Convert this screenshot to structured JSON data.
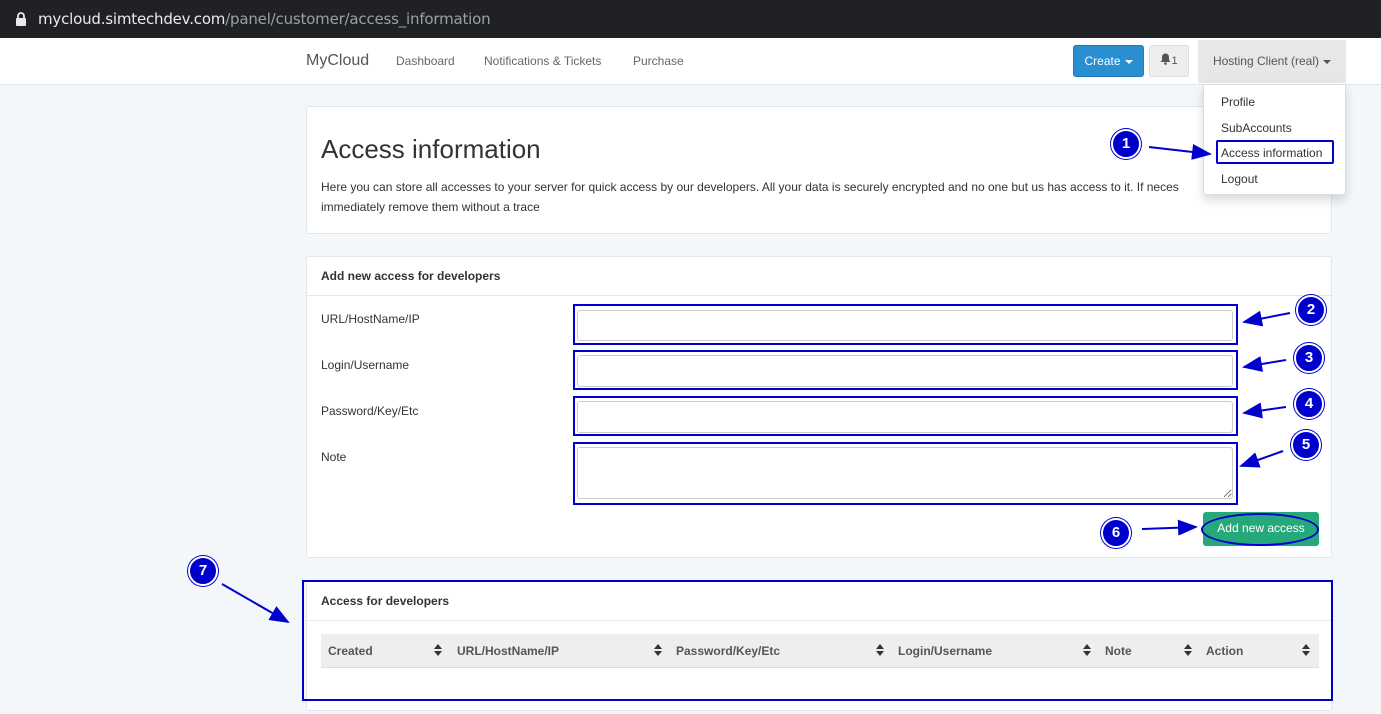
{
  "browser": {
    "url_host": "mycloud.simtechdev.com",
    "url_path": "/panel/customer/access_information"
  },
  "navbar": {
    "brand": "MyCloud",
    "links": [
      "Dashboard",
      "Notifications & Tickets",
      "Purchase"
    ],
    "create_label": "Create",
    "bell_count": "1",
    "user_label": "Hosting Client (real)"
  },
  "dropdown": {
    "items": [
      "Profile",
      "SubAccounts",
      "Access information",
      "Logout"
    ]
  },
  "intro": {
    "title": "Access information",
    "description": "Here you can store all accesses to your server for quick access by our developers. All your data is securely encrypted and no one but us has access to it. If neces immediately remove them without a trace"
  },
  "add_form": {
    "heading": "Add new access for developers",
    "fields": {
      "url_label": "URL/HostName/IP",
      "url_value": "",
      "login_label": "Login/Username",
      "login_value": "",
      "password_label": "Password/Key/Etc",
      "password_value": "",
      "note_label": "Note",
      "note_value": ""
    },
    "submit_label": "Add new access"
  },
  "access_table": {
    "heading": "Access for developers",
    "columns": [
      "Created",
      "URL/HostName/IP",
      "Password/Key/Etc",
      "Login/Username",
      "Note",
      "Action"
    ]
  },
  "annotations": {
    "markers": [
      "1",
      "2",
      "3",
      "4",
      "5",
      "6",
      "7"
    ],
    "color": "#0000cc"
  },
  "colors": {
    "primary": "#2a8fd1",
    "success": "#26a97a",
    "highlight": "#0000cc"
  }
}
